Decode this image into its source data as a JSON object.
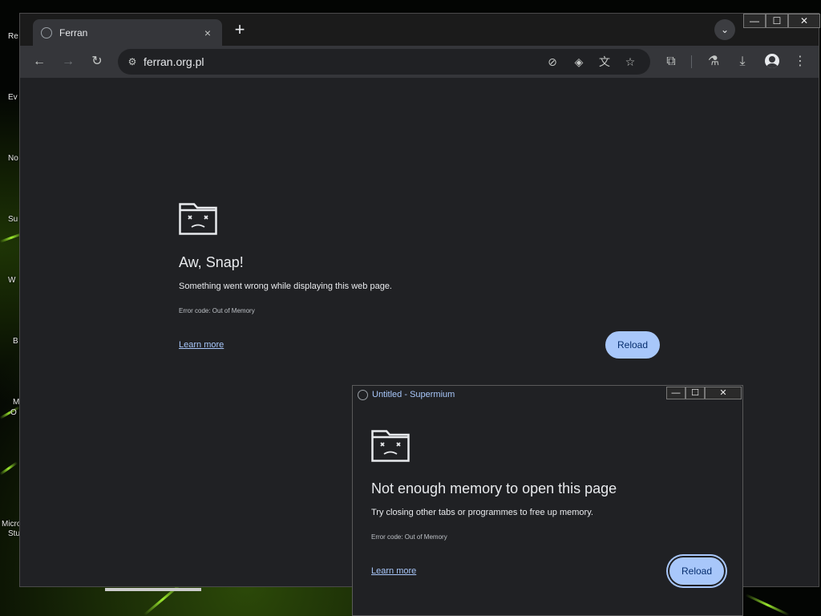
{
  "desktop": {
    "icon_labels": [
      "Re",
      "Ev",
      "No",
      "Su",
      "W",
      "B",
      "M",
      "O",
      "Micro",
      "Stu"
    ]
  },
  "browser": {
    "tab": {
      "title": "Ferran",
      "close_icon": "×"
    },
    "new_tab_icon": "+",
    "tab_search_icon": "⌄",
    "window_controls": {
      "minimize": "—",
      "maximize": "☐",
      "close": "✕"
    },
    "toolbar": {
      "back_icon": "←",
      "forward_icon": "→",
      "reload_icon": "↻",
      "url": "ferran.org.pl",
      "site_info_icon": "⚙",
      "icons": {
        "camera_off": "⊘",
        "lens": "◈",
        "translate": "文",
        "bookmark": "☆",
        "extensions": "⧉",
        "labs": "⚗",
        "download": "⤓",
        "menu": "⋮"
      }
    },
    "error_page": {
      "title": "Aw, Snap!",
      "message": "Something went wrong while displaying this web page.",
      "error_code": "Error code: Out of Memory",
      "learn_more": "Learn more",
      "reload": "Reload"
    }
  },
  "popup": {
    "title": "Untitled - Supermium",
    "window_controls": {
      "minimize": "—",
      "maximize": "☐",
      "close": "✕"
    },
    "error_page": {
      "title": "Not enough memory to open this page",
      "message": "Try closing other tabs or programmes to free up memory.",
      "error_code": "Error code: Out of Memory",
      "learn_more": "Learn more",
      "reload": "Reload"
    }
  }
}
